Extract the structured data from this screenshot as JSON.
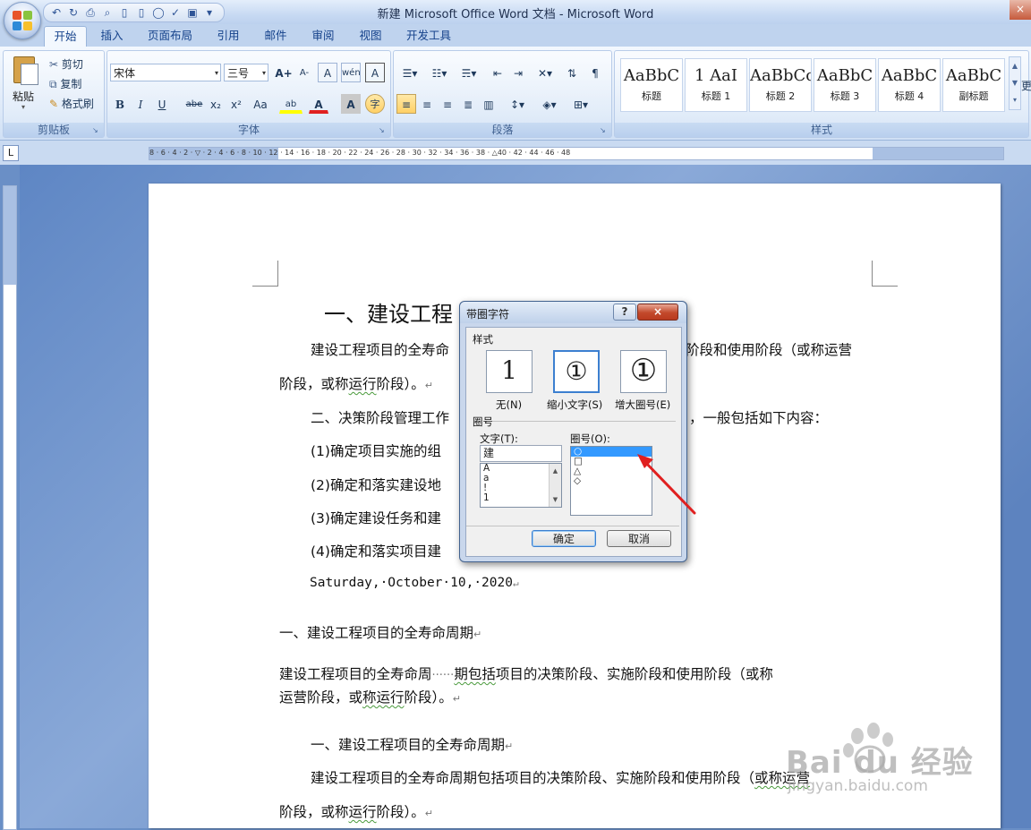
{
  "window": {
    "title": "新建 Microsoft Office Word 文档 - Microsoft Word",
    "close_glyph": "×"
  },
  "qat": {
    "undo": "↶",
    "redo": "↻",
    "print": "⎙",
    "preview": "⌕",
    "new": "▯",
    "open": "▯",
    "circle": "◯",
    "spell": "✓",
    "save": "▣",
    "more": "▾"
  },
  "tabs": [
    "开始",
    "插入",
    "页面布局",
    "引用",
    "邮件",
    "审阅",
    "视图",
    "开发工具"
  ],
  "ribbon": {
    "clipboard": {
      "label": "剪贴板",
      "paste": "粘贴",
      "cut": "剪切",
      "copy": "复制",
      "format_painter": "格式刷"
    },
    "font": {
      "label": "字体",
      "font_name": "宋体",
      "font_size": "三号",
      "bold": "B",
      "italic": "I",
      "underline": "U",
      "strike": "abe",
      "sub": "x₂",
      "sup": "x²",
      "case": "Aa",
      "grow": "A+",
      "shrink": "A-",
      "clear": "A",
      "phonetic": "wén",
      "border_char": "A",
      "highlight": "ab",
      "font_color": "A",
      "shade": "A",
      "enclose": "字"
    },
    "paragraph": {
      "label": "段落"
    },
    "styles": {
      "label": "样式",
      "items": [
        {
          "sample": "AaBbC",
          "name": "标题"
        },
        {
          "sample": "1 AaI",
          "name": "标题 1"
        },
        {
          "sample": "AaBbCc",
          "name": "标题 2"
        },
        {
          "sample": "AaBbC",
          "name": "标题 3"
        },
        {
          "sample": "AaBbC",
          "name": "标题 4"
        },
        {
          "sample": "AaBbC",
          "name": "副标题"
        }
      ],
      "more_label": "更"
    }
  },
  "ruler": {
    "corner": "L",
    "ticks": "8 · 6 · 4 · 2 · ▽ · 2 · 4 · 6 · 8 · 10 · 12 · 14 · 16 · 18 · 20 · 22 · 24 · 26 · 28 · 30 · 32 · 34 · 36 · 38 · △40 · 42 · 44 · 46 · 48"
  },
  "document": {
    "heading1": "一、建设工程",
    "p1_start": "建设工程项目的全寿命",
    "p1_end": "阶段和使用阶段（或称运营",
    "p1_line2_pre": "阶段，或称",
    "p1_line2_sq": "运行",
    "p1_line2_post": "阶段）。",
    "p2_start": "二、决策阶段管理工作",
    "p2_end": "，一般包括如下内容：",
    "li1": "(1)确定项目实施的组",
    "li2": "(2)确定和落实建设地",
    "li3": "(3)确定建设任务和建",
    "li4": "(4)确定和落实项目建",
    "date": "Saturday,·October·10,·2020",
    "h2": "一、建设工程项目的全寿命周期",
    "p3_line1_a": "建设工程项目的全寿命周",
    "p3_line1_dots": "······",
    "p3_line1_b": "期包括",
    "p3_line1_c": "项目的决策阶段、实施阶段和使用阶段（或称",
    "p3_line2_pre": "运营阶段，或",
    "p3_line2_sq": "称运行",
    "p3_line2_post": "阶段）。",
    "h3": "一、建设工程项目的全寿命周期",
    "p4_line1_a": "建设工程项目的全寿命周期包括项目的决策阶段、实施阶段和使用阶段（",
    "p4_line1_b": "或称运营",
    "p4_line2_pre": "阶段，或称",
    "p4_line2_sq": "运行",
    "p4_line2_post": "阶段）。",
    "para_mark": "↵"
  },
  "dialog": {
    "title": "带圈字符",
    "help": "?",
    "close": "×",
    "style_section": "样式",
    "style_none_glyph": "1",
    "style_shrink_glyph": "①",
    "style_enlarge_glyph": "①",
    "style_none": "无(N)",
    "style_shrink": "缩小文字(S)",
    "style_enlarge": "增大圈号(E)",
    "enclosure_section": "圈号",
    "text_label": "文字(T):",
    "text_value": "建",
    "text_list": [
      "A",
      "a",
      "!",
      "1"
    ],
    "enclosure_label": "圈号(O):",
    "enclosure_list": [
      "○",
      "□",
      "△",
      "◇"
    ],
    "ok": "确定",
    "cancel": "取消"
  },
  "watermark": {
    "brand": "Bai du 经验",
    "url": "jingyan.baidu.com"
  },
  "colors": {
    "accent_selection": "#3399ff",
    "annotation_arrow": "#e02020",
    "tab_text": "#15428b"
  }
}
